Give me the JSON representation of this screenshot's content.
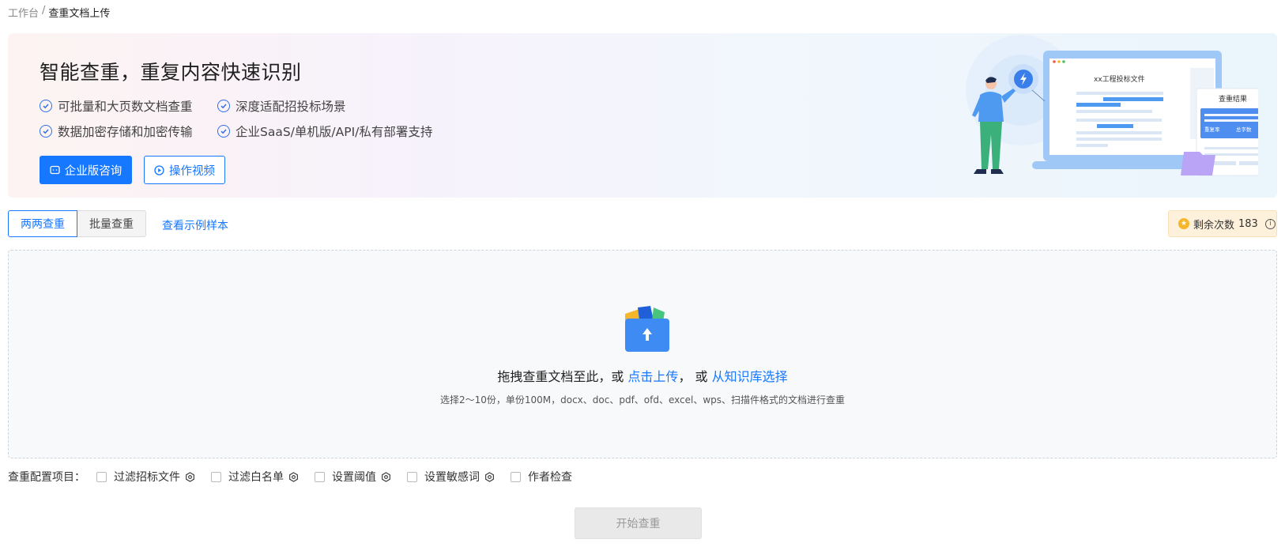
{
  "breadcrumb": {
    "root": "工作台",
    "separator": "/",
    "current": "查重文档上传"
  },
  "banner": {
    "title": "智能查重，重复内容快速识别",
    "features": [
      "可批量和大页数文档查重",
      "深度适配招投标场景",
      "数据加密存储和加密传输",
      "企业SaaS/单机版/API/私有部署支持"
    ],
    "consult_button": "企业版咨询",
    "video_button": "操作视频",
    "illustration": {
      "doc_title": "xx工程投标文件",
      "result_title": "查重结果",
      "result_label_rate": "重复率",
      "result_label_words": "总字数"
    }
  },
  "tabs": {
    "pairwise": "两两查重",
    "batch": "批量查重"
  },
  "sample_link": "查看示例样本",
  "remaining": {
    "label": "剩余次数",
    "count": "183"
  },
  "dropzone": {
    "text_prefix": "拖拽查重文档至此，或",
    "upload_link": "点击上传",
    "comma": "，",
    "or": "或",
    "kb_link": "从知识库选择",
    "hint": "选择2～10份，单份100M，docx、doc、pdf、ofd、excel、wps、扫描件格式的文档进行查重"
  },
  "config": {
    "label": "查重配置项目：",
    "options": [
      "过滤招标文件",
      "过滤白名单",
      "设置阈值",
      "设置敏感词",
      "作者检查"
    ]
  },
  "start_button": "开始查重",
  "colors": {
    "primary": "#1677ff",
    "remain_bg": "#fdf1dc"
  }
}
